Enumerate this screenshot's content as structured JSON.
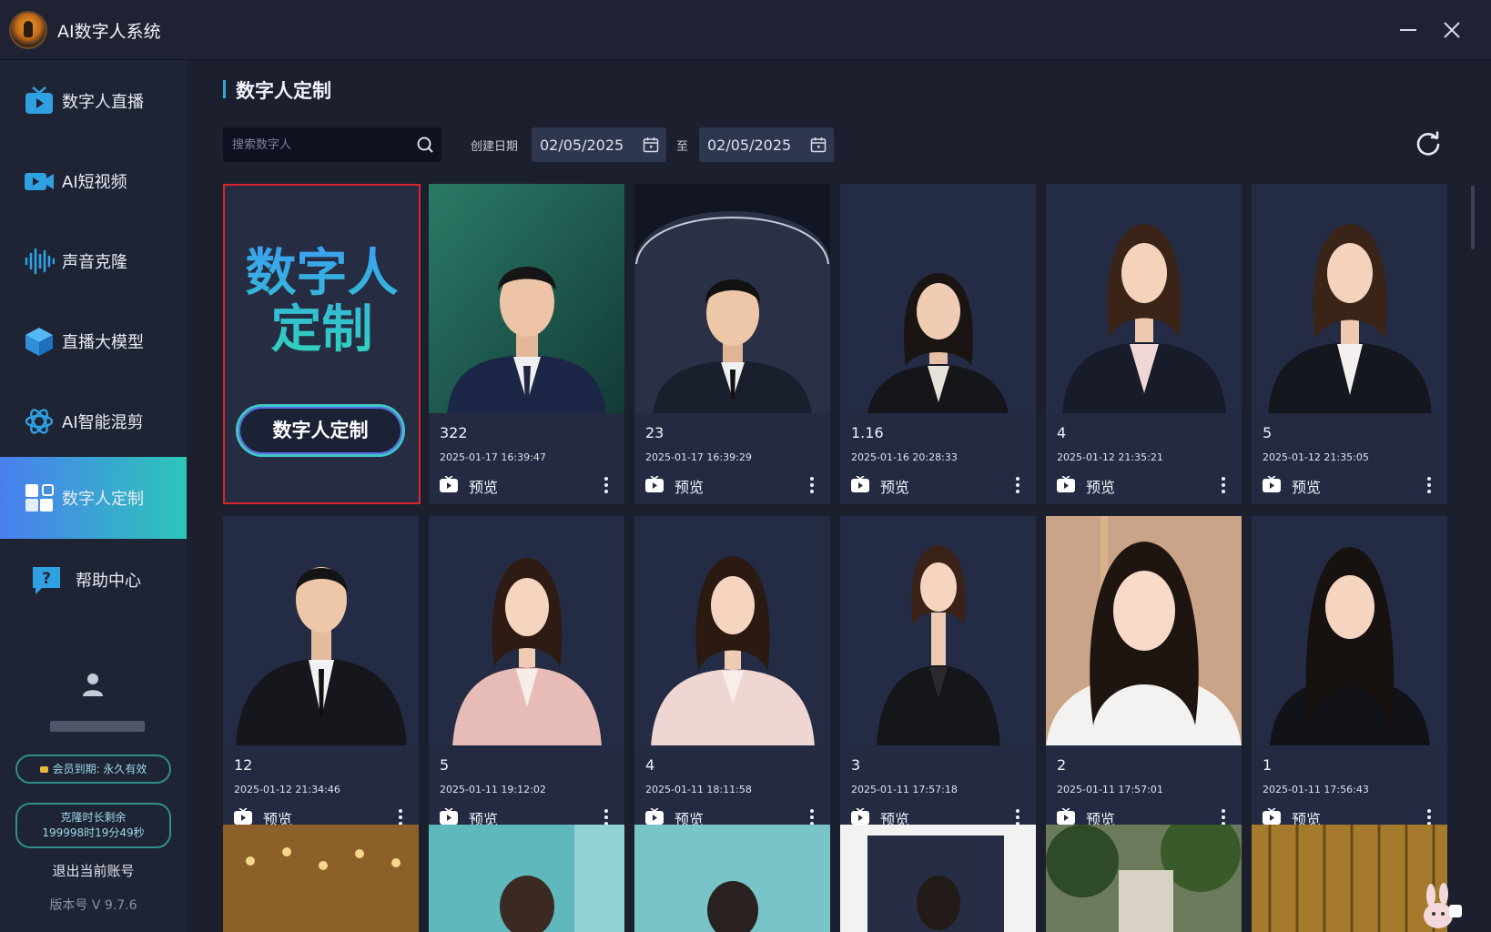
{
  "app": {
    "title": "AI数字人系统"
  },
  "sidebar": {
    "items": [
      {
        "label": "数字人直播",
        "icon": "tv-icon"
      },
      {
        "label": "AI短视频",
        "icon": "video-camera-icon"
      },
      {
        "label": "声音克隆",
        "icon": "waveform-icon"
      },
      {
        "label": "直播大模型",
        "icon": "cube-icon"
      },
      {
        "label": "AI智能混剪",
        "icon": "ai-spiral-icon"
      },
      {
        "label": "数字人定制",
        "icon": "puzzle-icon",
        "active": true
      },
      {
        "label": "帮助中心",
        "icon": "help-icon"
      }
    ],
    "vip": "会员到期: 永久有效",
    "duration_line1": "克隆时长剩余",
    "duration_line2": "199998时19分49秒",
    "logout": "退出当前账号",
    "version": "版本号 V 9.7.6"
  },
  "main": {
    "title": "数字人定制",
    "search_placeholder": "搜索数字人",
    "date_label": "创建日期",
    "date_from": "02/05/2025",
    "date_separator": "至",
    "date_to": "02/05/2025"
  },
  "create_card": {
    "title_line1": "数字人",
    "title_line2": "定制",
    "button": "数字人定制"
  },
  "preview_label": "预览",
  "cards": [
    {
      "name": "322",
      "time": "2025-01-17 16:39:47"
    },
    {
      "name": "23",
      "time": "2025-01-17 16:39:29"
    },
    {
      "name": "1.16",
      "time": "2025-01-16 20:28:33"
    },
    {
      "name": "4",
      "time": "2025-01-12 21:35:21"
    },
    {
      "name": "5",
      "time": "2025-01-12 21:35:05"
    },
    {
      "name": "12",
      "time": "2025-01-12 21:34:46"
    },
    {
      "name": "5",
      "time": "2025-01-11 19:12:02"
    },
    {
      "name": "4",
      "time": "2025-01-11 18:11:58"
    },
    {
      "name": "3",
      "time": "2025-01-11 17:57:18"
    },
    {
      "name": "2",
      "time": "2025-01-11 17:57:01"
    },
    {
      "name": "1",
      "time": "2025-01-11 17:56:43"
    }
  ],
  "colors": {
    "accent_from": "#4a7ef0",
    "accent_to": "#2cc6b8",
    "highlight_border": "#d8262c"
  }
}
